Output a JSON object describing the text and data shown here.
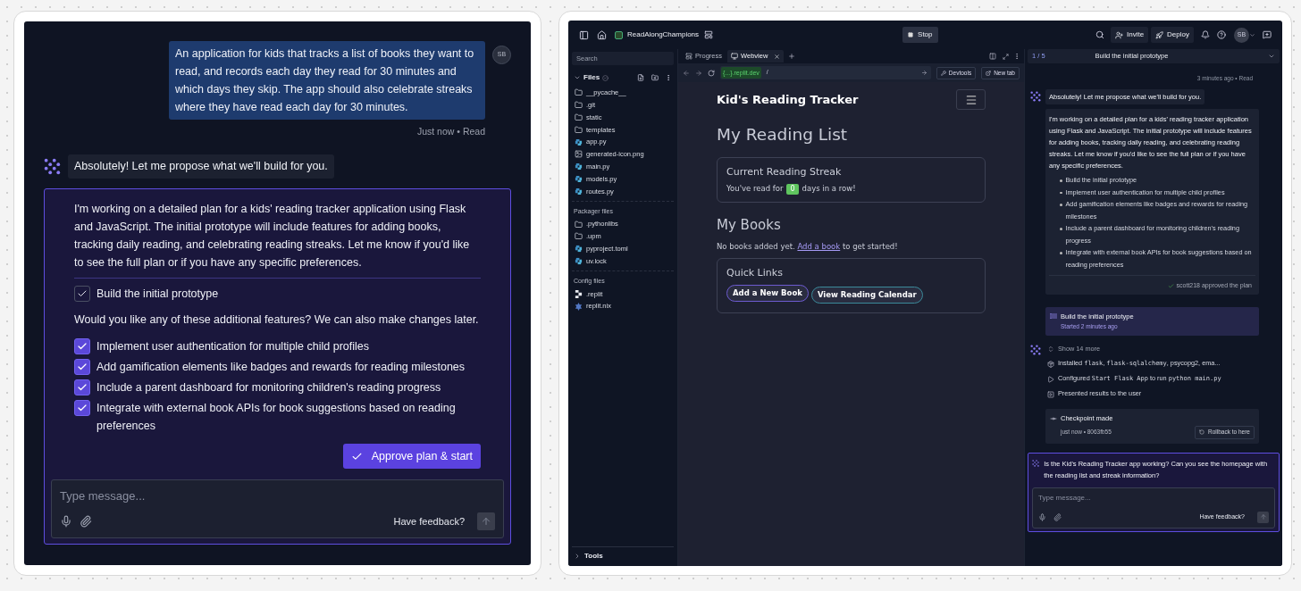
{
  "left": {
    "user_message": {
      "avatar": "SB",
      "text": "An application for kids that tracks a list of books they want to read, and records each day they read for 30 minutes and which days they skip. The app should also celebrate streaks where they have read each day for 30 minutes.",
      "meta": "Just now • Read"
    },
    "agent_message": "Absolutely! Let me propose what we'll build for you.",
    "plan": {
      "text": "I'm working on a detailed plan for a kids' reading tracker application using Flask and JavaScript. The initial prototype will include features for adding books, tracking daily reading, and celebrating reading streaks. Let me know if you'd like to see the full plan or if you have any specific preferences.",
      "base_item": {
        "label": "Build the initial prototype",
        "checked": true
      },
      "question": "Would you like any of these additional features? We can also make changes later.",
      "features": [
        {
          "label": "Implement user authentication for multiple child profiles",
          "checked": true
        },
        {
          "label": "Add gamification elements like badges and rewards for reading milestones",
          "checked": true
        },
        {
          "label": "Include a parent dashboard for monitoring children's reading progress",
          "checked": true
        },
        {
          "label": "Integrate with external book APIs for book suggestions based on reading preferences",
          "checked": true
        }
      ],
      "approve_button": "Approve plan & start"
    },
    "composer": {
      "placeholder": "Type message...",
      "feedback": "Have feedback?"
    }
  },
  "right": {
    "topbar": {
      "project": "ReadAlongChampions",
      "stop": "Stop",
      "invite": "Invite",
      "deploy": "Deploy",
      "avatar": "SB"
    },
    "files": {
      "search_placeholder": "Search",
      "title": "Files",
      "sections": [
        {
          "items": [
            {
              "name": "__pycache__",
              "kind": "folder"
            },
            {
              "name": ".git",
              "kind": "folder"
            },
            {
              "name": "static",
              "kind": "folder"
            },
            {
              "name": "templates",
              "kind": "folder"
            },
            {
              "name": "app.py",
              "kind": "python"
            },
            {
              "name": "generated-icon.png",
              "kind": "image"
            },
            {
              "name": "main.py",
              "kind": "python"
            },
            {
              "name": "models.py",
              "kind": "python"
            },
            {
              "name": "routes.py",
              "kind": "python"
            }
          ]
        },
        {
          "heading": "Packager files",
          "items": [
            {
              "name": ".pythonlibs",
              "kind": "folder"
            },
            {
              "name": ".upm",
              "kind": "folder"
            },
            {
              "name": "pyproject.toml",
              "kind": "python"
            },
            {
              "name": "uv.lock",
              "kind": "python"
            }
          ]
        },
        {
          "heading": "Config files",
          "items": [
            {
              "name": ".replit",
              "kind": "replit"
            },
            {
              "name": "replit.nix",
              "kind": "nix"
            }
          ]
        }
      ],
      "tools": "Tools"
    },
    "webview": {
      "tabs": [
        {
          "label": "Progress",
          "kind": "progress",
          "selected": false
        },
        {
          "label": "Webview",
          "kind": "webview",
          "selected": true
        }
      ],
      "url_host": "{...}.replit.dev",
      "url_path": "/",
      "devtools": "Devtools",
      "new_tab": "New tab",
      "page": {
        "brand": "Kid's Reading Tracker",
        "heading": "My Reading List",
        "streak": {
          "title": "Current Reading Streak",
          "before": "You've read for",
          "count": "0",
          "after": "days in a row!"
        },
        "books_heading": "My Books",
        "empty_before": "No books added yet.",
        "empty_link": "Add a book",
        "empty_after": "to get started!",
        "quick_links": {
          "title": "Quick Links",
          "buttons": [
            {
              "label": "Add a New Book",
              "color": "#6d5bd0"
            },
            {
              "label": "View Reading Calendar",
              "color": "#3b8a9a"
            }
          ]
        }
      }
    },
    "chat": {
      "step": "1 / 5",
      "step_title": "Build the initial prototype",
      "meta": "3 minutes ago • Read",
      "agent_message": "Absolutely! Let me propose what we'll build for you.",
      "plan_text": "I'm working on a detailed plan for a kids' reading tracker application using Flask and JavaScript. The initial prototype will include features for adding books, tracking daily reading, and celebrating reading streaks. Let me know if you'd like to see the full plan or if you have any specific preferences.",
      "plan_items": [
        "Build the initial prototype",
        "Implement user authentication for multiple child profiles",
        "Add gamification elements like badges and rewards for reading milestones",
        "Include a parent dashboard for monitoring children's reading progress",
        "Integrate with external book APIs for book suggestions based on reading preferences"
      ],
      "approved": "scott218 approved the plan",
      "task": {
        "title": "Build the initial prototype",
        "status": "Started 2 minutes ago"
      },
      "activity": [
        {
          "kind": "expand",
          "parts": [
            {
              "text": "Show 14 more",
              "code": false
            }
          ]
        },
        {
          "kind": "package",
          "parts": [
            {
              "text": "Installed ",
              "code": false
            },
            {
              "text": "flask",
              "code": true
            },
            {
              "text": ", ",
              "code": false
            },
            {
              "text": "flask-sqlalchemy",
              "code": true
            },
            {
              "text": ", psycopg2, ema...",
              "code": false
            }
          ]
        },
        {
          "kind": "run",
          "parts": [
            {
              "text": "Configured ",
              "code": false
            },
            {
              "text": "Start Flask App",
              "code": true
            },
            {
              "text": " to run ",
              "code": false
            },
            {
              "text": "python main.py",
              "code": true
            }
          ]
        },
        {
          "kind": "present",
          "parts": [
            {
              "text": "Presented results to the user",
              "code": false
            }
          ]
        }
      ],
      "checkpoint": {
        "title": "Checkpoint made",
        "meta": "just now • 8063fb55",
        "rollback": "Rollback to here"
      },
      "question": "Is the Kid's Reading Tracker app working? Can you see the homepage with the reading list and streak information?",
      "composer": {
        "placeholder": "Type message...",
        "feedback": "Have feedback?"
      }
    }
  }
}
